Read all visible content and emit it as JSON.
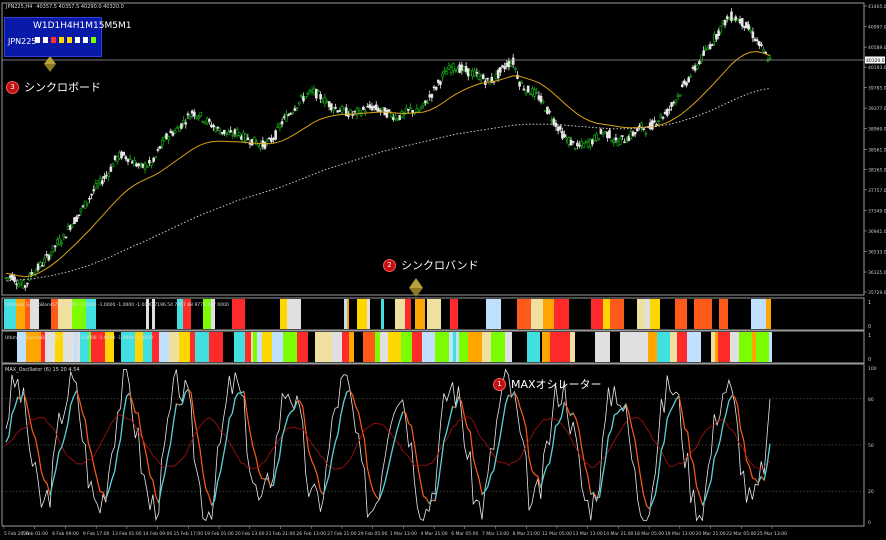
{
  "window": {
    "symbol_info": "JPN225,H4",
    "prices": "40357.5 40357.5 40290.0 40320.0"
  },
  "sync_board": {
    "timeframes": "W1D1H4H1M15M5M1",
    "symbol": "JPN225",
    "cells": [
      "#ffffff",
      "#ffffff",
      "#ff3030",
      "#ffd700",
      "#ffd700",
      "#ffffff",
      "#ffffff",
      "#7cfc00"
    ]
  },
  "annotations": [
    {
      "num": "3",
      "label": "シンクロボード"
    },
    {
      "num": "2",
      "label": "シンクロバンド"
    },
    {
      "num": "1",
      "label": "MAXオシレーター"
    }
  ],
  "price_axis": [
    "41405.0",
    "40997.0",
    "40589.0",
    "40193.0",
    "39785.0",
    "39377.0",
    "38969.0",
    "38561.0",
    "38165.0",
    "37757.0",
    "37349.0",
    "36941.0",
    "36533.0",
    "36125.0",
    "35729.0"
  ],
  "current_price": "40320.0",
  "band1": {
    "title": "Ultimate SyncroBand(7) -1.0000 -1.0000 -1.0000 -1.0000 -1.0000 7196.54 7467 88.9774 467 0000",
    "scale": [
      "1",
      "0"
    ]
  },
  "band2": {
    "title": "Ultimate SyncroBand(7) -1.0000 -1.0000 -1.0000 -1.0000 -1.0000",
    "scale": [
      "1",
      "0"
    ]
  },
  "oscillator": {
    "title": "MAX_Oscillator (6) 15 20 4.54",
    "levels": [
      "100",
      "80",
      "50",
      "20",
      "0"
    ]
  },
  "time_axis": [
    "5 Feb 2024",
    "7 Feb 01:00",
    "8 Feb 09:00",
    "9 Feb 17:00",
    "13 Feb 01:00",
    "14 Feb 09:00",
    "15 Feb 17:00",
    "19 Feb 01:00",
    "20 Feb 13:00",
    "21 Feb 21:00",
    "26 Feb 13:00",
    "27 Feb 21:00",
    "29 Feb 05:00",
    "1 Mar 13:00",
    "4 Mar 21:00",
    "6 Mar 05:00",
    "7 Mar 13:00",
    "8 Mar 21:00",
    "12 Mar 05:00",
    "13 Mar 13:00",
    "14 Mar 21:00",
    "18 Mar 05:00",
    "19 Mar 13:00",
    "20 Mar 21:00",
    "22 Mar 05:00",
    "25 Mar 13:00"
  ],
  "chart_data": {
    "type": "candlestick",
    "price_range": [
      35729,
      41405
    ],
    "close_path": [
      36000,
      36050,
      35900,
      35850,
      36100,
      36200,
      36350,
      36500,
      36700,
      36800,
      37050,
      37200,
      37400,
      37600,
      37800,
      37950,
      38100,
      38350,
      38450,
      38400,
      38300,
      38200,
      38250,
      38300,
      38600,
      38800,
      38900,
      39000,
      39150,
      39300,
      39250,
      39150,
      39050,
      38950,
      38900,
      38850,
      38900,
      38800,
      38750,
      38700,
      38650,
      38700,
      38850,
      39100,
      39250,
      39400,
      39550,
      39650,
      39700,
      39600,
      39500,
      39400,
      39350,
      39300,
      39250,
      39300,
      39350,
      39400,
      39350,
      39300,
      39250,
      39200,
      39250,
      39350,
      39300,
      39400,
      39600,
      39800,
      40000,
      40150,
      40200,
      40150,
      40100,
      40050,
      40000,
      39900,
      39950,
      40100,
      40250,
      40300,
      39900,
      39750,
      39700,
      39600,
      39400,
      39200,
      39000,
      38800,
      38700,
      38600,
      38650,
      38700,
      38800,
      38900,
      38850,
      38700,
      38750,
      38800,
      38900,
      39000,
      38950,
      39100,
      39200,
      39300,
      39500,
      39700,
      39900,
      40100,
      40300,
      40500,
      40700,
      40900,
      41100,
      41200,
      41150,
      41050,
      40900,
      40700,
      40500,
      40320
    ],
    "ma_fast_path": [
      36100,
      36080,
      36050,
      36030,
      36050,
      36100,
      36170,
      36250,
      36350,
      36460,
      36580,
      36700,
      36830,
      36960,
      37100,
      37240,
      37380,
      37520,
      37650,
      37760,
      37850,
      37920,
      37980,
      38040,
      38110,
      38200,
      38290,
      38380,
      38470,
      38560,
      38630,
      38680,
      38710,
      38720,
      38720,
      38710,
      38710,
      38700,
      38690,
      38680,
      38670,
      38670,
      38690,
      38730,
      38790,
      38860,
      38940,
      39020,
      39100,
      39160,
      39200,
      39230,
      39250,
      39260,
      39260,
      39270,
      39280,
      39290,
      39300,
      39300,
      39290,
      39280,
      39270,
      39280,
      39290,
      39300,
      39340,
      39400,
      39480,
      39570,
      39650,
      39720,
      39780,
      39830,
      39870,
      39890,
      39910,
      39940,
      39980,
      40020,
      40010,
      39970,
      39930,
      39880,
      39800,
      39700,
      39590,
      39470,
      39360,
      39260,
      39180,
      39120,
      39080,
      39060,
      39040,
      39020,
      39000,
      38990,
      38990,
      39000,
      39000,
      39020,
      39050,
      39090,
      39160,
      39240,
      39340,
      39450,
      39570,
      39700,
      39830,
      39970,
      40110,
      40250,
      40360,
      40440,
      40490,
      40500,
      40470,
      40420
    ],
    "ma_slow_path": [
      35950,
      35960,
      35970,
      35980,
      35990,
      36010,
      36030,
      36050,
      36080,
      36110,
      36140,
      36180,
      36220,
      36260,
      36310,
      36360,
      36410,
      36470,
      36530,
      36590,
      36650,
      36700,
      36760,
      36820,
      36880,
      36940,
      37000,
      37060,
      37120,
      37180,
      37240,
      37290,
      37340,
      37390,
      37440,
      37490,
      37540,
      37580,
      37620,
      37660,
      37700,
      37740,
      37780,
      37820,
      37870,
      37920,
      37970,
      38020,
      38070,
      38120,
      38170,
      38210,
      38250,
      38290,
      38330,
      38370,
      38410,
      38450,
      38490,
      38530,
      38560,
      38590,
      38620,
      38650,
      38680,
      38710,
      38740,
      38770,
      38800,
      38830,
      38860,
      38880,
      38900,
      38920,
      38940,
      38960,
      38980,
      39000,
      39020,
      39040,
      39050,
      39060,
      39060,
      39060,
      39060,
      39060,
      39050,
      39040,
      39030,
      39020,
      39010,
      39000,
      38990,
      38980,
      38970,
      38970,
      38970,
      38970,
      38980,
      38990,
      39000,
      39010,
      39030,
      39050,
      39080,
      39110,
      39150,
      39190,
      39240,
      39290,
      39340,
      39400,
      39460,
      39520,
      39580,
      39630,
      39680,
      39720,
      39750,
      39770
    ]
  }
}
